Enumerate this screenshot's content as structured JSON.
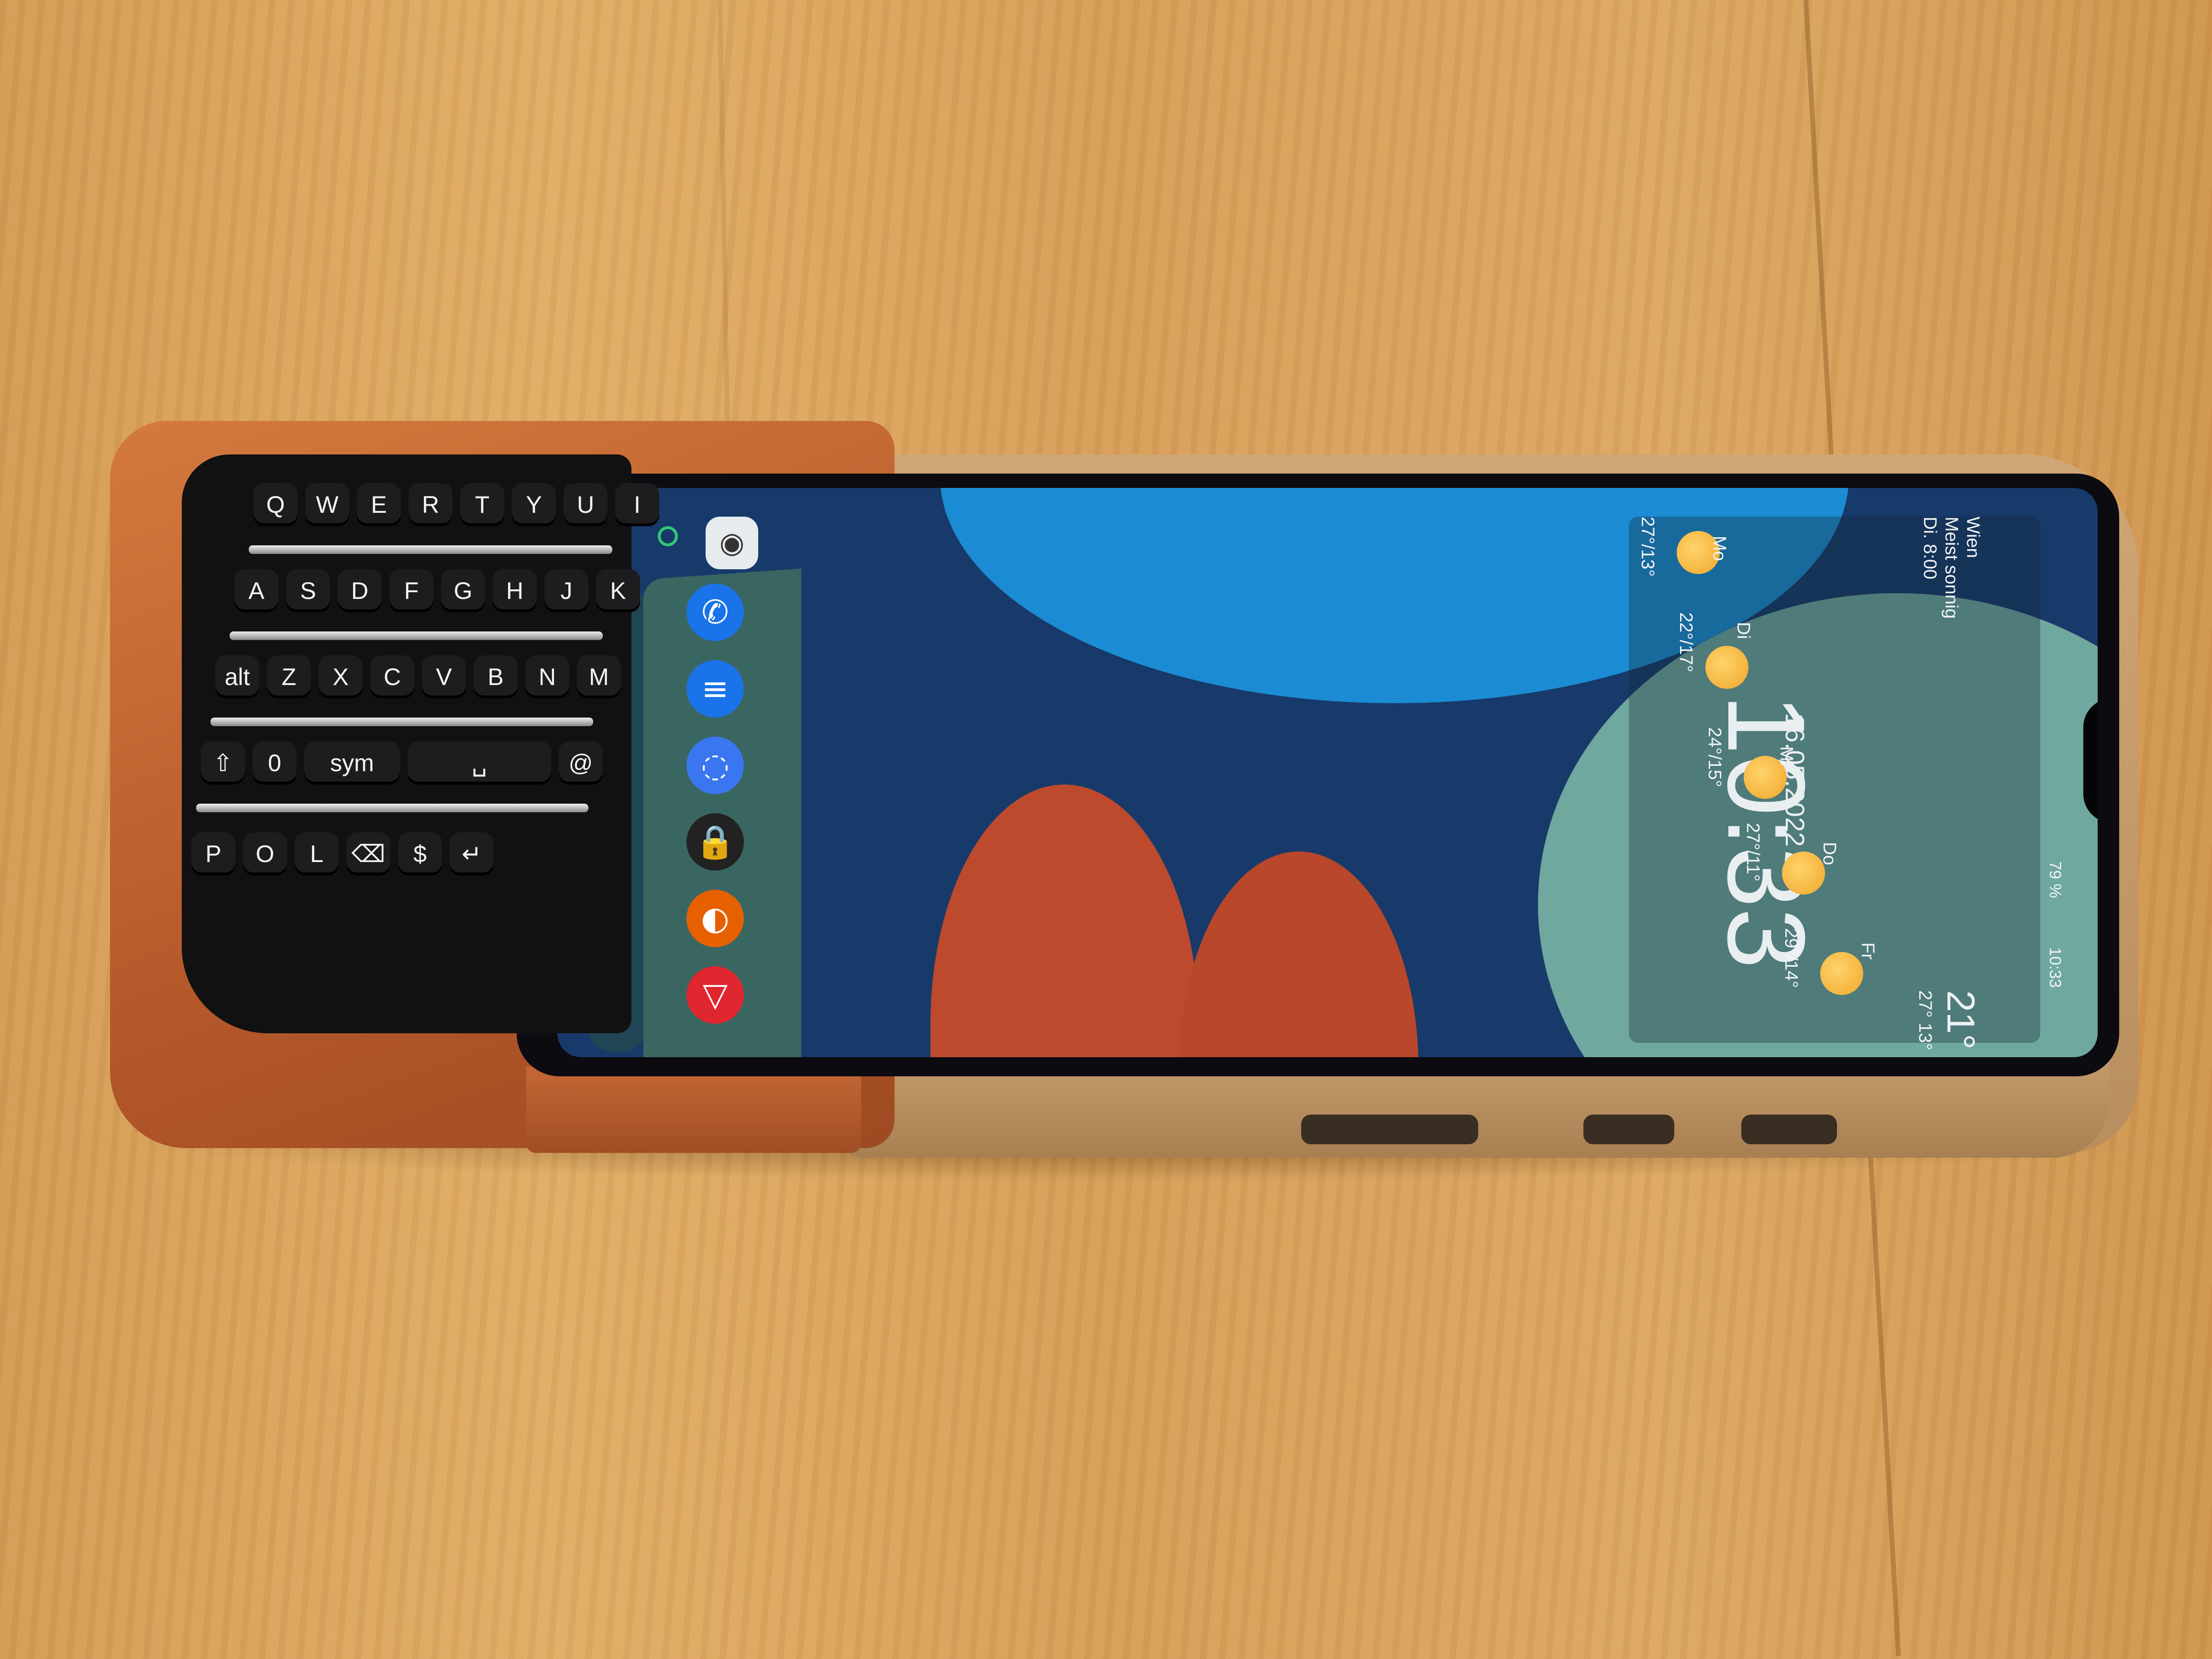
{
  "scene": "3D-printed keyboard case on an Android phone",
  "screen": {
    "widget": {
      "location": "Wien",
      "condition": "Meist sonnig",
      "alarm": "Di. 8:00",
      "time": "10:33",
      "date": "16.05.2022",
      "current_temp": "21°",
      "current_range": "27° 13°",
      "forecast": [
        {
          "day": "Mo",
          "range": "27°/13°"
        },
        {
          "day": "Di",
          "range": "22°/17°"
        },
        {
          "day": "Mi",
          "range": "24°/15°"
        },
        {
          "day": "Do",
          "range": "27°/11°"
        },
        {
          "day": "Fr",
          "range": "29°/14°"
        }
      ]
    },
    "status": {
      "battery": "79 %",
      "clock": "10:33"
    },
    "dock_icons": [
      "phone-icon",
      "messages-icon",
      "signal-icon",
      "lock-icon",
      "firefox-icon",
      "delta-icon"
    ]
  },
  "keyboard": {
    "rows": [
      [
        "Q",
        "W",
        "E",
        "R",
        "T",
        "Y",
        "U",
        "I",
        "O",
        "P"
      ],
      [
        "A",
        "S",
        "D",
        "F",
        "G",
        "H",
        "J",
        "K",
        "L",
        "⌫"
      ],
      [
        "alt",
        "Z",
        "X",
        "C",
        "V",
        "B",
        "N",
        "M",
        "$",
        "↵"
      ],
      [
        "⇧",
        "0",
        "sym",
        "␣",
        "@"
      ]
    ]
  }
}
